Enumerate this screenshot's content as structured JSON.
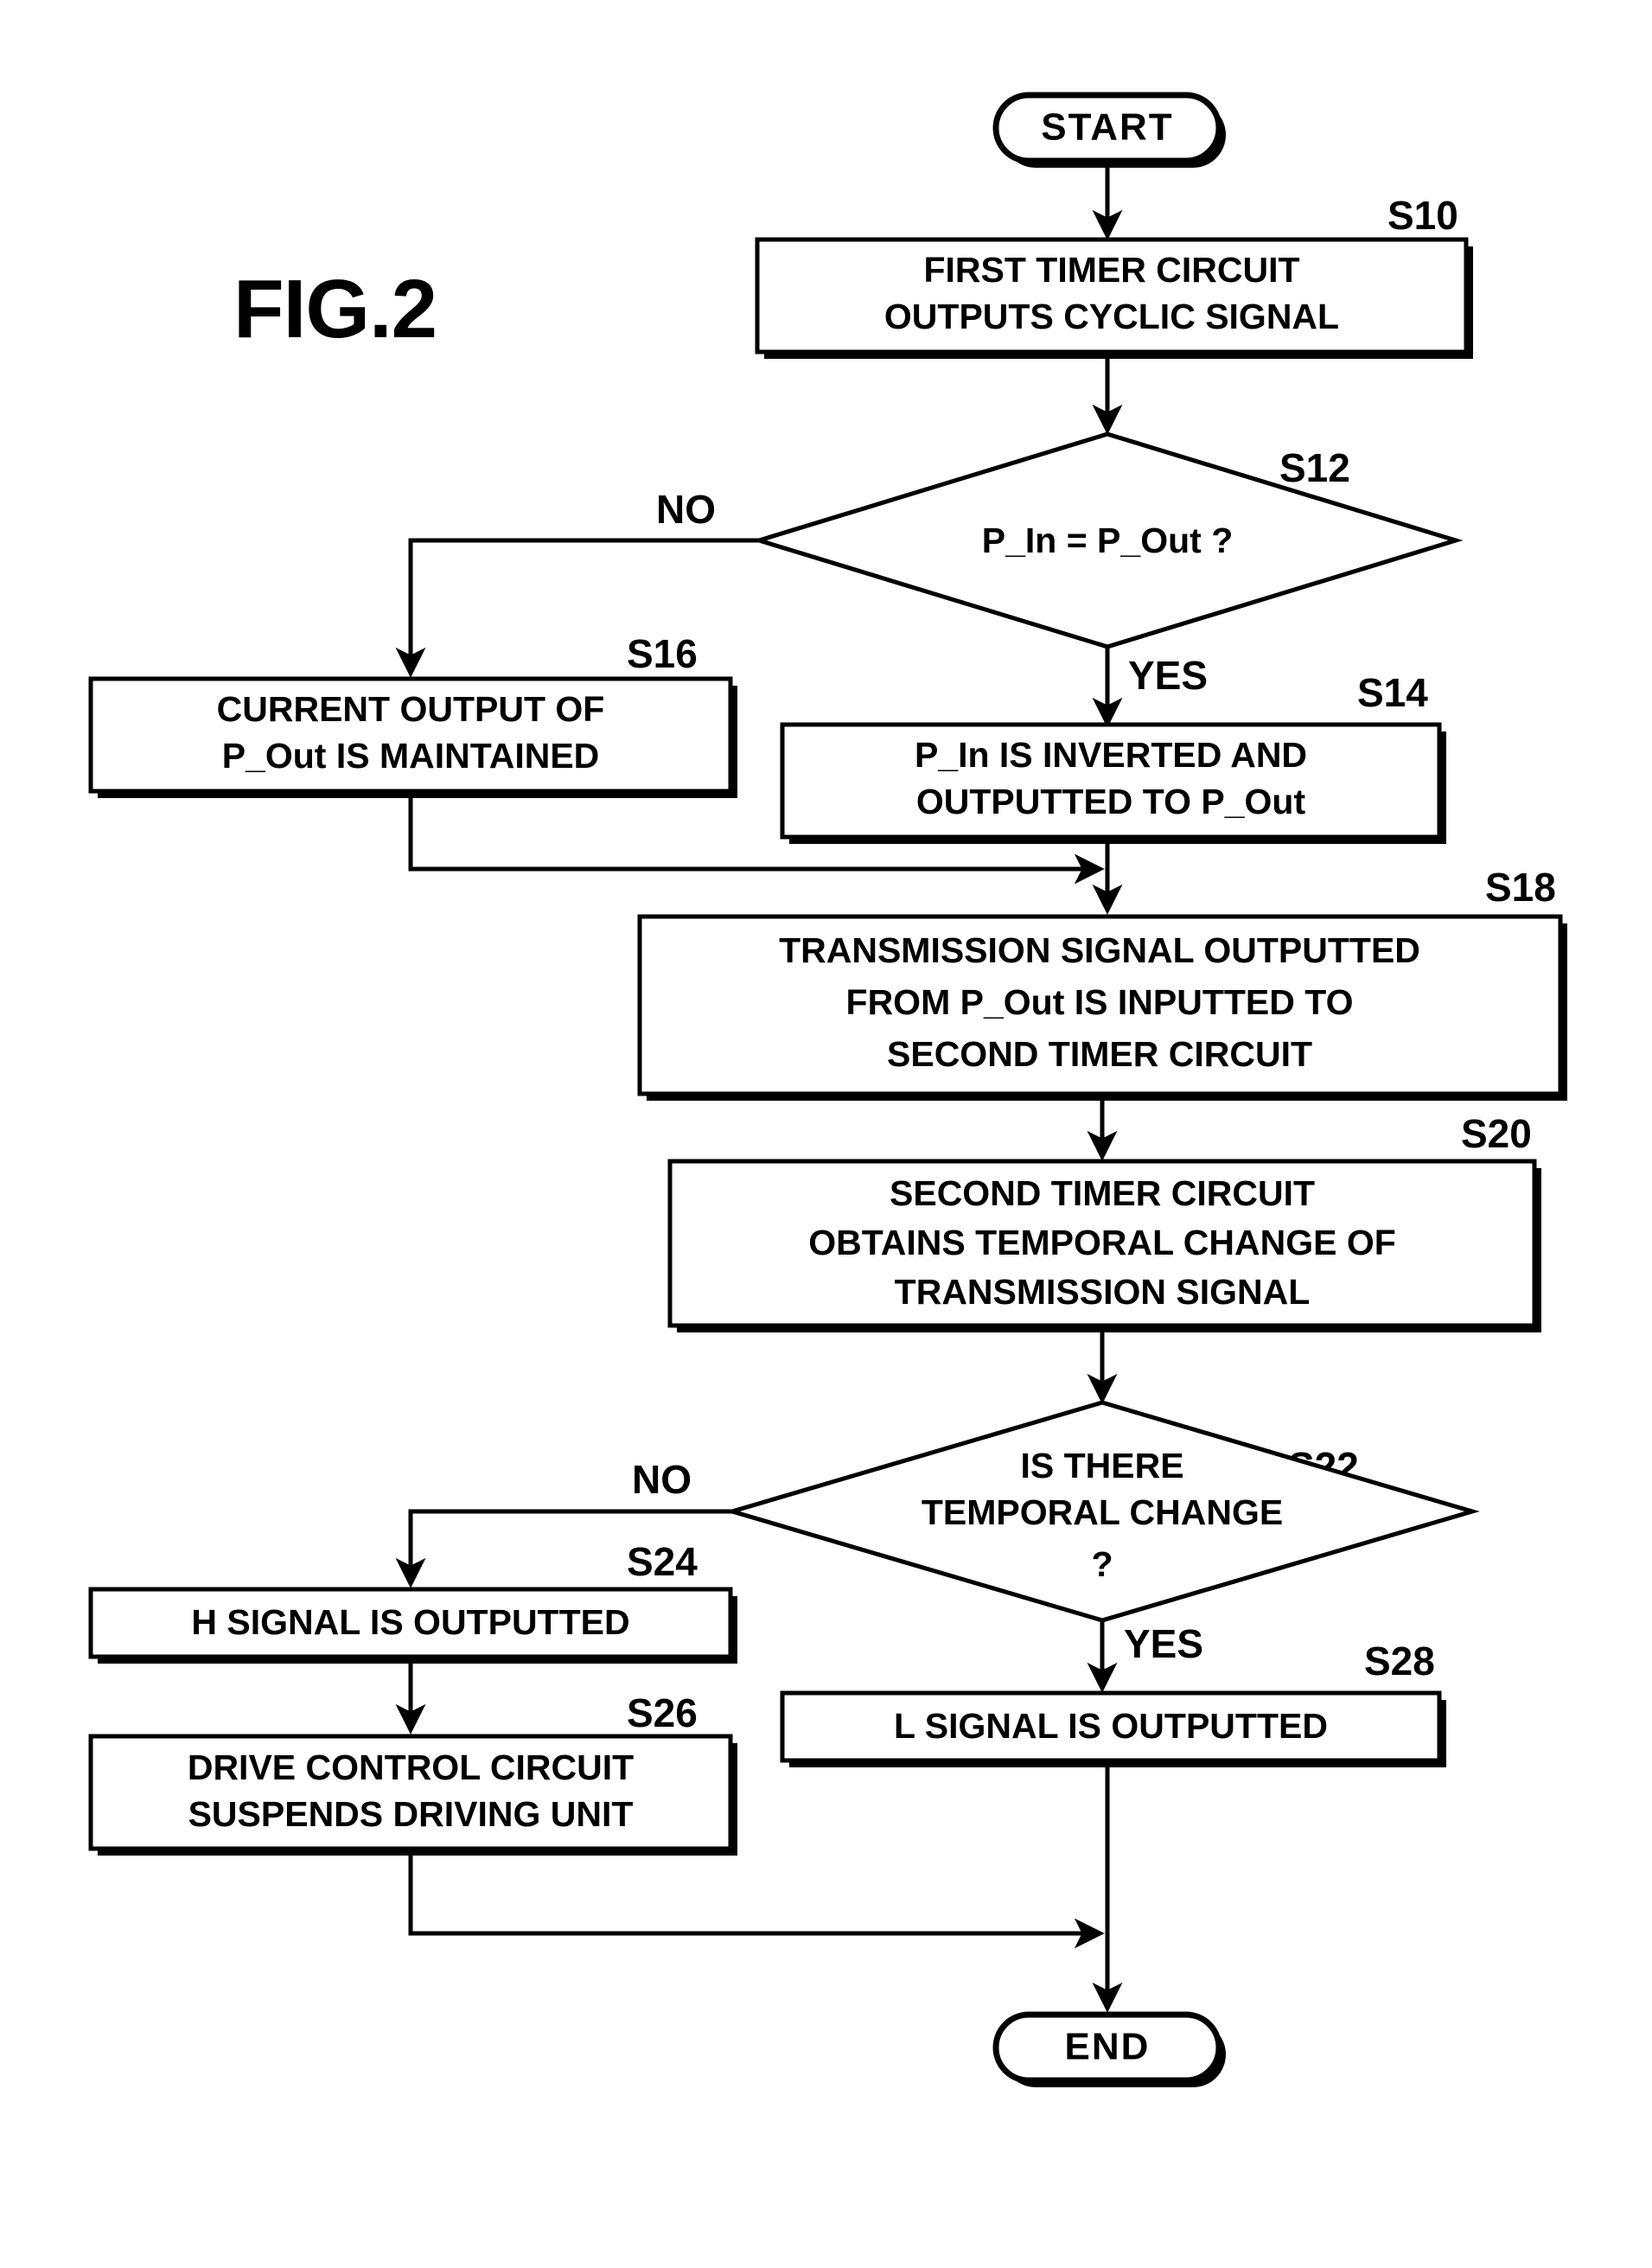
{
  "figure": {
    "title": "FIG.2",
    "kind": "flowchart"
  },
  "terminators": {
    "start": "START",
    "end": "END"
  },
  "branch_labels": {
    "s12_no": "NO",
    "s12_yes": "YES",
    "s22_no": "NO",
    "s22_yes": "YES"
  },
  "step_labels": {
    "s10": "S10",
    "s12": "S12",
    "s14": "S14",
    "s16": "S16",
    "s18": "S18",
    "s20": "S20",
    "s22": "S22",
    "s24": "S24",
    "s26": "S26",
    "s28": "S28"
  },
  "nodes": {
    "s10": {
      "id": "S10",
      "type": "process",
      "lines": [
        "FIRST TIMER CIRCUIT",
        "OUTPUTS CYCLIC SIGNAL"
      ]
    },
    "s12": {
      "id": "S12",
      "type": "decision",
      "lines": [
        "P_In = P_Out ?"
      ]
    },
    "s14": {
      "id": "S14",
      "type": "process",
      "lines": [
        "P_In IS INVERTED AND",
        "OUTPUTTED TO P_Out"
      ]
    },
    "s16": {
      "id": "S16",
      "type": "process",
      "lines": [
        "CURRENT OUTPUT OF",
        "P_Out IS MAINTAINED"
      ]
    },
    "s18": {
      "id": "S18",
      "type": "process",
      "lines": [
        "TRANSMISSION SIGNAL OUTPUTTED",
        "FROM P_Out IS INPUTTED TO",
        "SECOND TIMER CIRCUIT"
      ]
    },
    "s20": {
      "id": "S20",
      "type": "process",
      "lines": [
        "SECOND TIMER CIRCUIT",
        "OBTAINS TEMPORAL CHANGE OF",
        "TRANSMISSION SIGNAL"
      ]
    },
    "s22": {
      "id": "S22",
      "type": "decision",
      "lines": [
        "IS THERE",
        "TEMPORAL CHANGE",
        "?"
      ]
    },
    "s24": {
      "id": "S24",
      "type": "process",
      "lines": [
        "H SIGNAL IS OUTPUTTED"
      ]
    },
    "s26": {
      "id": "S26",
      "type": "process",
      "lines": [
        "DRIVE CONTROL CIRCUIT",
        "SUSPENDS DRIVING UNIT"
      ]
    },
    "s28": {
      "id": "S28",
      "type": "process",
      "lines": [
        "L SIGNAL IS OUTPUTTED"
      ]
    }
  },
  "colors": {
    "ink": "#000000",
    "paper": "#ffffff"
  }
}
